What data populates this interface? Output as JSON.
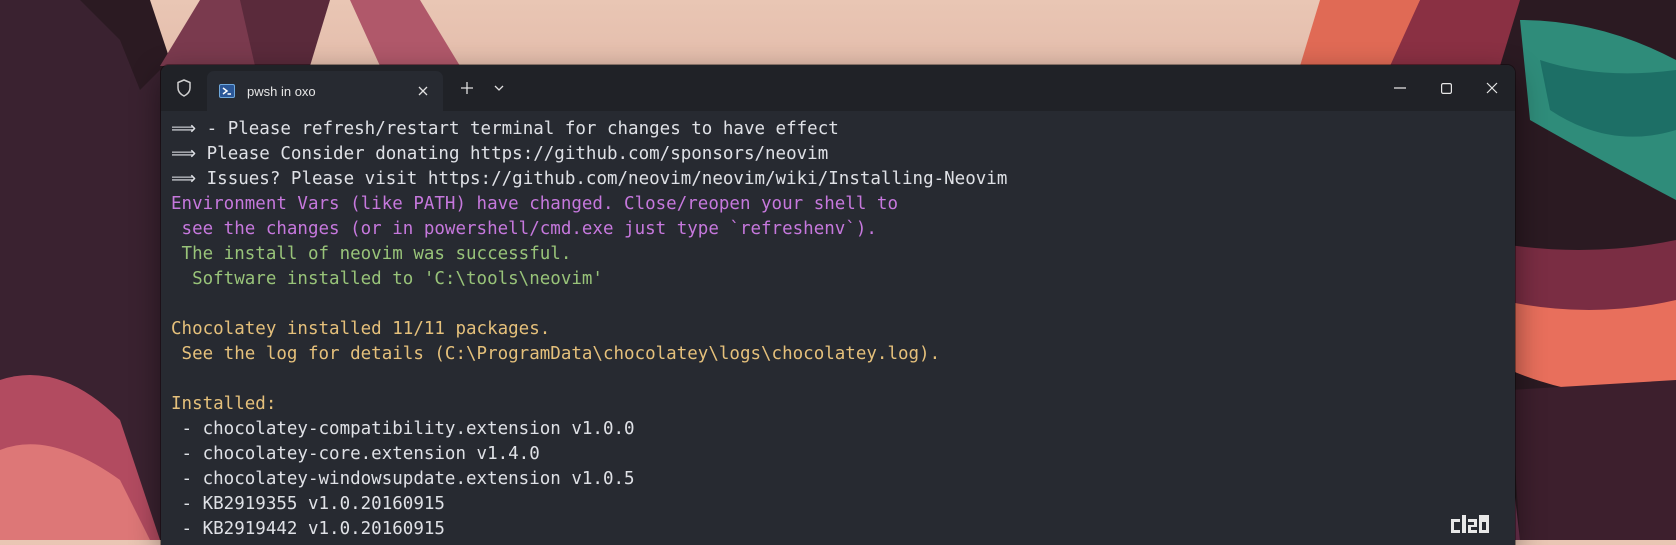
{
  "window": {
    "tab_title": "pwsh in oxo"
  },
  "terminal_lines": [
    {
      "text": "⟹ - Please refresh/restart terminal for changes to have effect",
      "color": "#dfe1e6"
    },
    {
      "text": "⟹ Please Consider donating https://github.com/sponsors/neovim",
      "color": "#dfe1e6"
    },
    {
      "text": "⟹ Issues? Please visit https://github.com/neovim/neovim/wiki/Installing-Neovim",
      "color": "#dfe1e6"
    },
    {
      "text": "Environment Vars (like PATH) have changed. Close/reopen your shell to",
      "color": "#c678dd"
    },
    {
      "text": " see the changes (or in powershell/cmd.exe just type `refreshenv`).",
      "color": "#c678dd"
    },
    {
      "text": " The install of neovim was successful.",
      "color": "#98c379"
    },
    {
      "text": "  Software installed to 'C:\\tools\\neovim'",
      "color": "#98c379"
    },
    {
      "text": "",
      "color": "#dfe1e6"
    },
    {
      "text": "Chocolatey installed 11/11 packages.",
      "color": "#e5c07b"
    },
    {
      "text": " See the log for details (C:\\ProgramData\\chocolatey\\logs\\chocolatey.log).",
      "color": "#e5c07b"
    },
    {
      "text": "",
      "color": "#dfe1e6"
    },
    {
      "text": "Installed:",
      "color": "#e5c07b"
    },
    {
      "text": " - chocolatey-compatibility.extension v1.0.0",
      "color": "#dfe1e6"
    },
    {
      "text": " - chocolatey-core.extension v1.4.0",
      "color": "#dfe1e6"
    },
    {
      "text": " - chocolatey-windowsupdate.extension v1.0.5",
      "color": "#dfe1e6"
    },
    {
      "text": " - KB2919355 v1.0.20160915",
      "color": "#dfe1e6"
    },
    {
      "text": " - KB2919442 v1.0.20160915",
      "color": "#dfe1e6"
    }
  ],
  "watermark": "clsb",
  "icons": {
    "shield": "shield-icon",
    "tab": "powershell-icon",
    "close_tab": "close-icon",
    "new_tab": "plus-icon",
    "dropdown": "chevron-down-icon",
    "minimize": "minimize-icon",
    "maximize": "maximize-icon",
    "close_window": "close-icon"
  }
}
